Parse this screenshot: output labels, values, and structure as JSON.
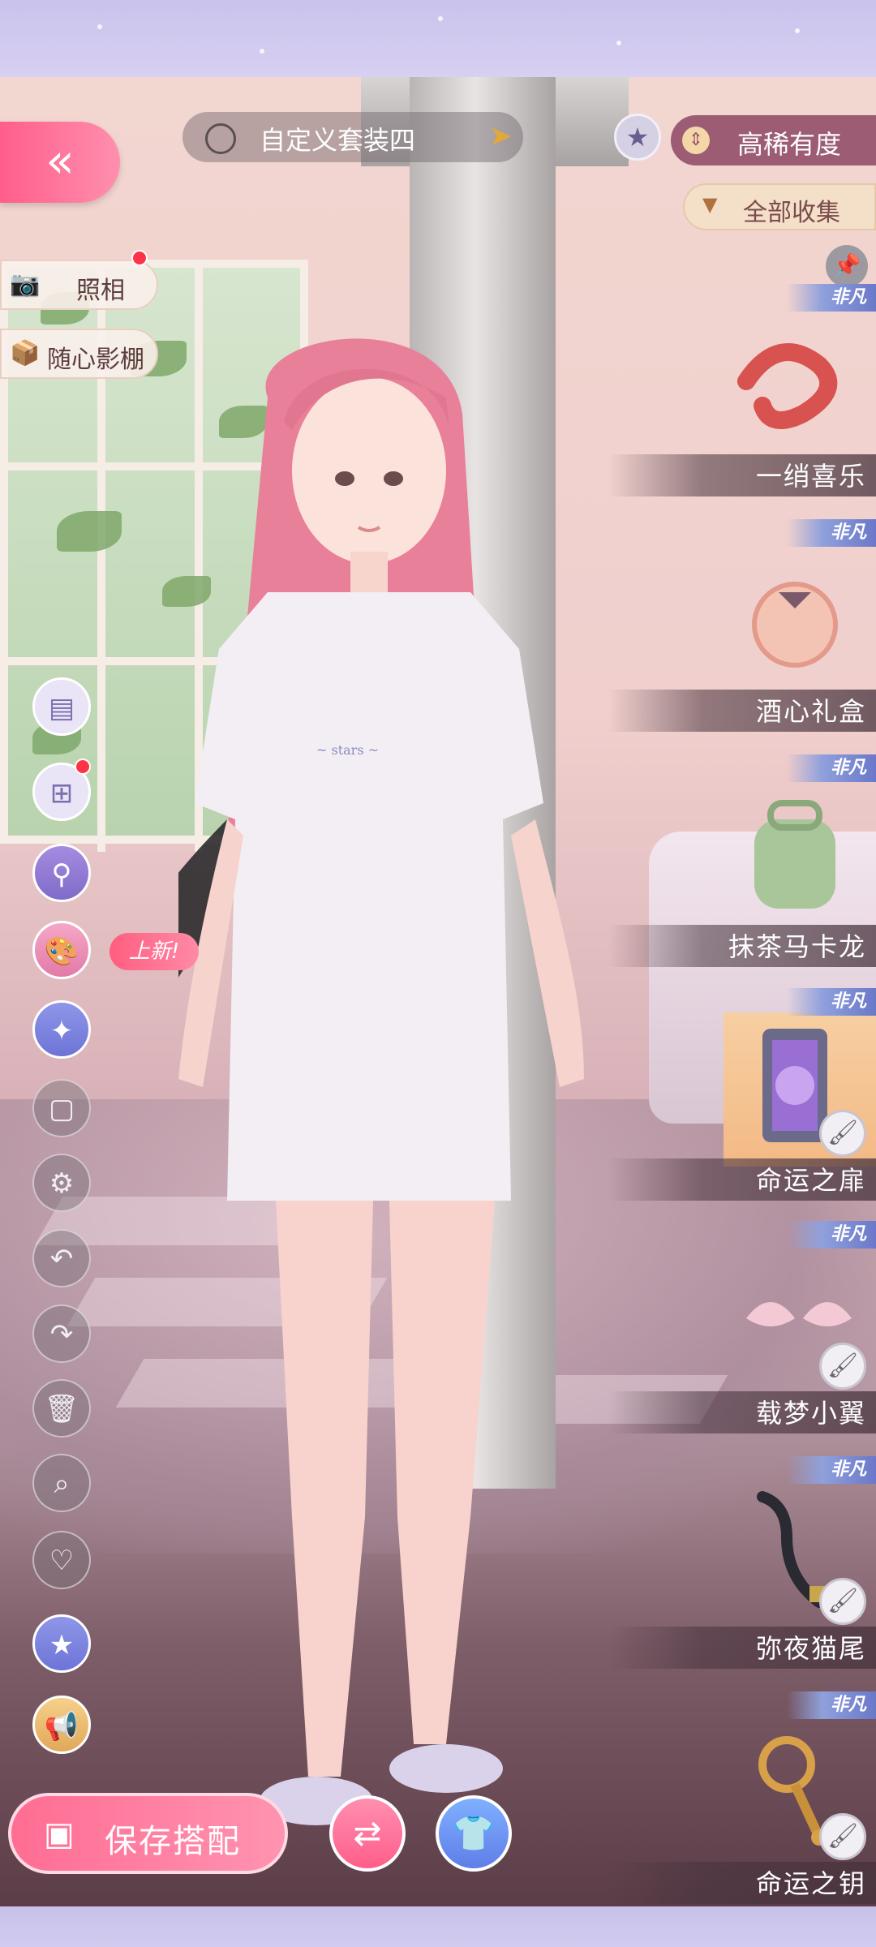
{
  "outfit": {
    "suit_name": "自定义套装四"
  },
  "header": {
    "sort_label": "高稀有度",
    "filter_label": "全部收集"
  },
  "left_menu": {
    "photo_label": "照相",
    "studio_label": "随心影棚",
    "new_badge": "上新!"
  },
  "bottom": {
    "save_label": "保存搭配"
  },
  "items": [
    {
      "name": "一绡喜乐",
      "rarity": "非凡"
    },
    {
      "name": "酒心礼盒",
      "rarity": "非凡"
    },
    {
      "name": "抹茶马卡龙",
      "rarity": "非凡"
    },
    {
      "name": "命运之扉",
      "rarity": "非凡",
      "selected": true
    },
    {
      "name": "载梦小翼",
      "rarity": "非凡"
    },
    {
      "name": "弥夜猫尾",
      "rarity": "非凡"
    },
    {
      "name": "命运之钥",
      "rarity": "非凡"
    }
  ],
  "colors": {
    "accent_pink": "#ff6d93",
    "sort_bg": "#9b5c74",
    "filter_bg": "#f4dfc9",
    "rarity_badge": "#6a78c8"
  },
  "icons": [
    "back-arrow-icon",
    "suit-icon",
    "star-icon",
    "sort-icon",
    "filter-icon",
    "camera-icon",
    "box-icon",
    "layout-icon",
    "add-layer-icon",
    "search-filter-icon",
    "palette-icon",
    "magic-star-icon",
    "frame-icon",
    "gear-icon",
    "undo-icon",
    "redo-icon",
    "trash-icon",
    "search-icon",
    "heart-icon",
    "favorite-icon",
    "megaphone-icon",
    "pin-icon",
    "brush-icon",
    "swap-icon",
    "wardrobe-icon"
  ]
}
